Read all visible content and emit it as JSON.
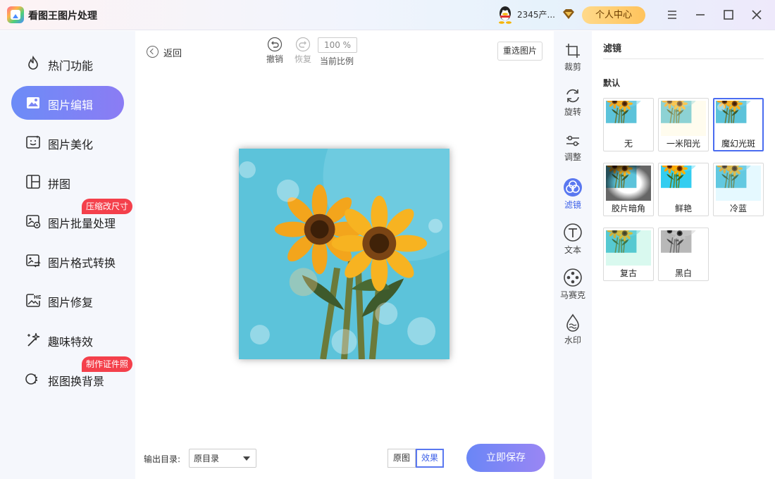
{
  "app": {
    "title": "看图王图片处理"
  },
  "header": {
    "username": "2345产...",
    "personal_center": "个人中心"
  },
  "sidebar": {
    "items": [
      {
        "label": "热门功能"
      },
      {
        "label": "图片编辑",
        "active": true
      },
      {
        "label": "图片美化"
      },
      {
        "label": "拼图"
      },
      {
        "label": "图片批量处理",
        "badge": "压缩改尺寸"
      },
      {
        "label": "图片格式转换"
      },
      {
        "label": "图片修复"
      },
      {
        "label": "趣味特效"
      },
      {
        "label": "抠图换背景",
        "badge": "制作证件照"
      }
    ]
  },
  "toolbar": {
    "back": "返回",
    "undo": "撤销",
    "redo": "恢复",
    "zoom_value": "100 %",
    "zoom_label": "当前比例",
    "reselect": "重选图片"
  },
  "footer": {
    "output_label": "输出目录:",
    "output_value": "原目录",
    "original": "原图",
    "effect": "效果",
    "save": "立即保存"
  },
  "tools": [
    {
      "label": "裁剪",
      "icon": "crop-icon"
    },
    {
      "label": "旋转",
      "icon": "rotate-icon"
    },
    {
      "label": "调整",
      "icon": "adjust-icon"
    },
    {
      "label": "滤镜",
      "icon": "filter-icon",
      "active": true
    },
    {
      "label": "文本",
      "icon": "text-icon"
    },
    {
      "label": "马赛克",
      "icon": "mosaic-icon"
    },
    {
      "label": "水印",
      "icon": "watermark-icon"
    }
  ],
  "filter_panel": {
    "title": "滤镜",
    "group": "默认",
    "filters": [
      {
        "label": "无"
      },
      {
        "label": "一米阳光"
      },
      {
        "label": "魔幻光斑",
        "selected": true
      },
      {
        "label": "胶片暗角"
      },
      {
        "label": "鲜艳"
      },
      {
        "label": "冷蓝"
      },
      {
        "label": "复古"
      },
      {
        "label": "黑白"
      }
    ]
  },
  "colors": {
    "accent": "#5a78f0",
    "badge": "#f4404b",
    "personal_btn": "#ffc35c"
  }
}
